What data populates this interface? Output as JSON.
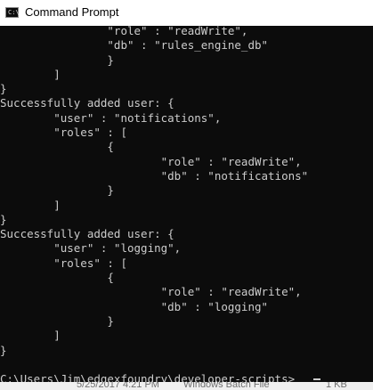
{
  "window": {
    "title": "Command Prompt",
    "icon": "command-prompt-icon",
    "icon_text": "C:\\"
  },
  "console": {
    "background": "#0c0c0c",
    "foreground": "#cccccc",
    "lines": [
      "                \"role\" : \"readWrite\",",
      "                \"db\" : \"rules_engine_db\"",
      "                }",
      "        ]",
      "}",
      "Successfully added user: {",
      "        \"user\" : \"notifications\",",
      "        \"roles\" : [",
      "                {",
      "                        \"role\" : \"readWrite\",",
      "                        \"db\" : \"notifications\"",
      "                }",
      "        ]",
      "}",
      "Successfully added user: {",
      "        \"user\" : \"logging\",",
      "        \"roles\" : [",
      "                {",
      "                        \"role\" : \"readWrite\",",
      "                        \"db\" : \"logging\"",
      "                }",
      "        ]",
      "}",
      "",
      "C:\\Users\\Jim\\edgexfoundry\\developer-scripts>"
    ]
  },
  "statusbar": {
    "date": "5/25/2017 4:21 PM",
    "type": "Windows Batch File",
    "size": "1 KB"
  }
}
